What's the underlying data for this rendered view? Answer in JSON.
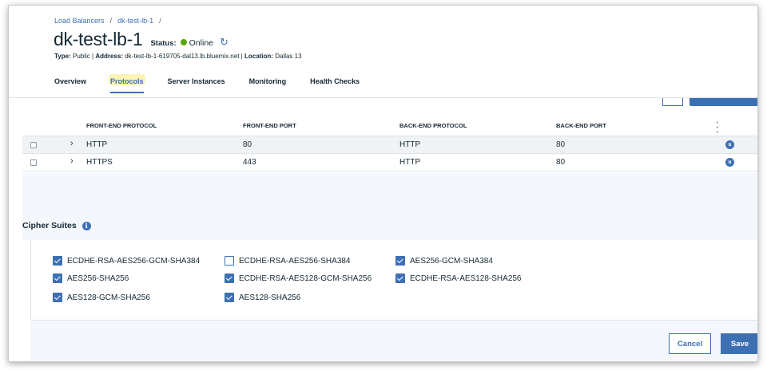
{
  "breadcrumb": {
    "item1": "Load Balancers",
    "sep1": "/",
    "item2": "dk-test-lb-1",
    "sep2": "/"
  },
  "header": {
    "title": "dk-test-lb-1",
    "status_label": "Status:",
    "status_value": "Online",
    "status_color": "#5aa700",
    "type_label": "Type:",
    "type_value": "Public",
    "address_label": "Address:",
    "address_value": "dk-test-lb-1-619705-dal13.lb.bluemix.net",
    "location_label": "Location:",
    "location_value": "Dallas 13"
  },
  "tabs": [
    {
      "label": "Overview",
      "active": false
    },
    {
      "label": "Protocols",
      "active": true
    },
    {
      "label": "Server Instances",
      "active": false
    },
    {
      "label": "Monitoring",
      "active": false
    },
    {
      "label": "Health Checks",
      "active": false
    }
  ],
  "protocols": {
    "section_title_partial": "Protocols",
    "columns": [
      "FRONT-END PROTOCOL",
      "FRONT-END PORT",
      "BACK-END PROTOCOL",
      "BACK-END PORT"
    ],
    "rows": [
      {
        "frontend_protocol": "HTTP",
        "frontend_port": "80",
        "backend_protocol": "HTTP",
        "backend_port": "80"
      },
      {
        "frontend_protocol": "HTTPS",
        "frontend_port": "443",
        "backend_protocol": "HTTP",
        "backend_port": "80"
      }
    ]
  },
  "cipher_suites": {
    "title": "Cipher Suites",
    "items": [
      {
        "label": "ECDHE-RSA-AES256-GCM-SHA384",
        "checked": true
      },
      {
        "label": "ECDHE-RSA-AES256-SHA384",
        "checked": false
      },
      {
        "label": "AES256-GCM-SHA384",
        "checked": true
      },
      {
        "label": "AES256-SHA256",
        "checked": true
      },
      {
        "label": "ECDHE-RSA-AES128-GCM-SHA256",
        "checked": true
      },
      {
        "label": "ECDHE-RSA-AES128-SHA256",
        "checked": true
      },
      {
        "label": "AES128-GCM-SHA256",
        "checked": true
      },
      {
        "label": "AES128-SHA256",
        "checked": true
      }
    ]
  },
  "footer": {
    "cancel_label": "Cancel",
    "save_label": "Save"
  },
  "colors": {
    "accent": "#3d70b2",
    "text": "#152935",
    "highlight": "#f6e65a"
  }
}
